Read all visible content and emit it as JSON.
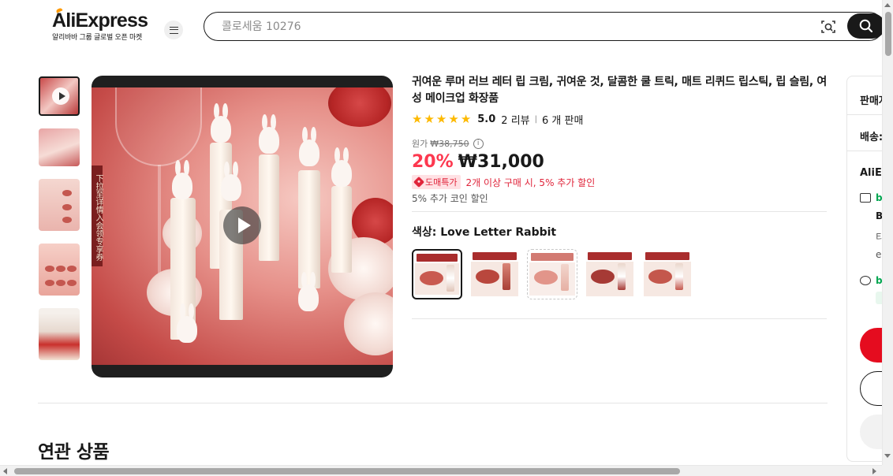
{
  "header": {
    "logo_text": "AliExpress",
    "logo_sub": "알리바바 그룹 글로벌 오픈 마켓",
    "search_placeholder": "콜로세움 10276",
    "icons": [
      "menu-icon",
      "camera-search-icon",
      "search-icon"
    ]
  },
  "gallery": {
    "thumbnails": [
      "video",
      "image",
      "image",
      "image",
      "image"
    ],
    "side_banner": "下拉至详情入会领专享券"
  },
  "product": {
    "title": "귀여운 루머 러브 레터 립 크림, 귀여운 것, 달콤한 쿨 트릭, 매트 리퀴드 립스틱, 립 슬림, 여성 메이크업 화장품",
    "rating": "5.0",
    "reviews": "2 리뷰",
    "sold": "6 개 판매",
    "original_label": "원가",
    "original_price": "₩38,750",
    "discount": "20%",
    "price": "₩31,000",
    "promo_badge": "도매특가",
    "promo_text": "2개 이상 구매 시, 5% 추가 할인",
    "coin_text": "5% 추가 코인 할인",
    "color_label": "색상:",
    "color_value": "Love Letter Rabbit",
    "swatch_count": 5,
    "colors": {
      "accent": "#fd384f",
      "star": "#fdb900",
      "promo_bg": "#ffe1e4"
    }
  },
  "sidebar": {
    "seller_label": "판매자",
    "shipping_label": "배송:",
    "ali_label": "AliE",
    "line_b": "B",
    "line_t": "티",
    "line_e": "e",
    "buy_now_color": "#e50c1f"
  },
  "related": {
    "title": "연관 상품"
  }
}
